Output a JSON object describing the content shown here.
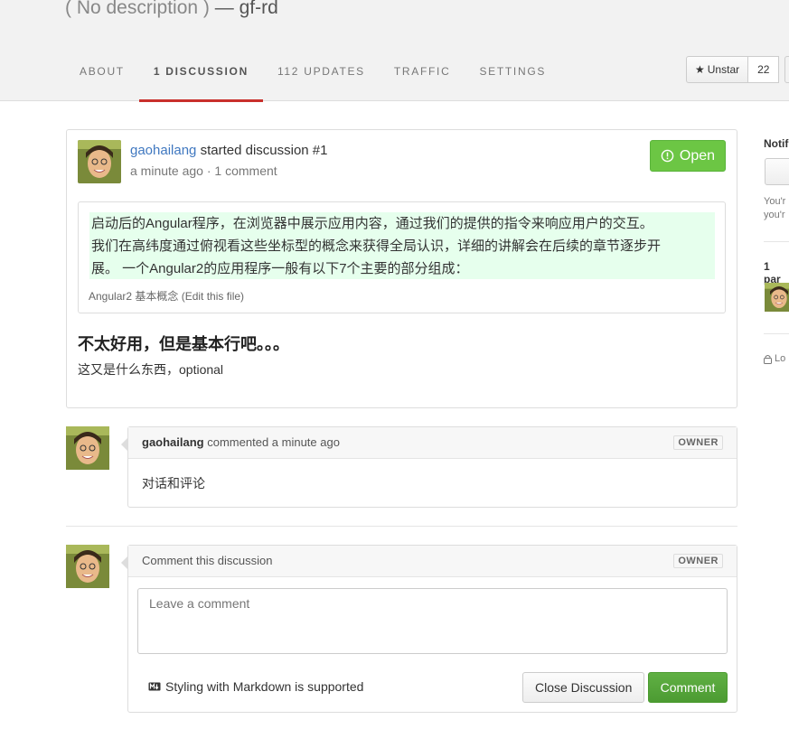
{
  "repo": {
    "description": "( No description )",
    "dash": "—",
    "name": "gf-rd"
  },
  "tabs": [
    {
      "label": "ABOUT"
    },
    {
      "label": "1 DISCUSSION"
    },
    {
      "label": "112 UPDATES"
    },
    {
      "label": "TRAFFIC"
    },
    {
      "label": "SETTINGS"
    }
  ],
  "star": {
    "label": "Unstar",
    "count": "22"
  },
  "discussion": {
    "author": "gaohailang",
    "action": "started discussion #1",
    "time": "a minute ago",
    "separator": "·",
    "comment_count": "1 comment",
    "status": "Open",
    "snippet_lines": [
      "启动后的Angular程序，在浏览器中展示应用内容，通过我们的提供的指令来响应用户的交互。",
      "我们在高纬度通过俯视看这些坐标型的概念来获得全局认识，详细的讲解会在后续的章节逐步开",
      "展。 一个Angular2的应用程序一般有以下7个主要的部分组成："
    ],
    "snippet_file": "Angular2 基本概念 (Edit this file)",
    "title": "不太好用，但是基本行吧。。。",
    "body": "这又是什么东西，optional"
  },
  "comment": {
    "author": "gaohailang",
    "action": "commented a minute ago",
    "role": "OWNER",
    "body": "对话和评论"
  },
  "new_comment": {
    "heading": "Comment this discussion",
    "role": "OWNER",
    "placeholder": "Leave a comment",
    "markdown_note": "Styling with Markdown is supported",
    "close_label": "Close Discussion",
    "submit_label": "Comment"
  },
  "sidebar": {
    "notifications_label": "Notif",
    "notifications_text": [
      "You'r",
      "you'r"
    ],
    "participants_label": "1 par",
    "lock_label": "Lo"
  },
  "colors": {
    "open": "#6cc644",
    "comment_btn": "#55a532",
    "link": "#4078c0",
    "active_tab": "#c9302c",
    "snippet_bg": "#e6ffed"
  }
}
